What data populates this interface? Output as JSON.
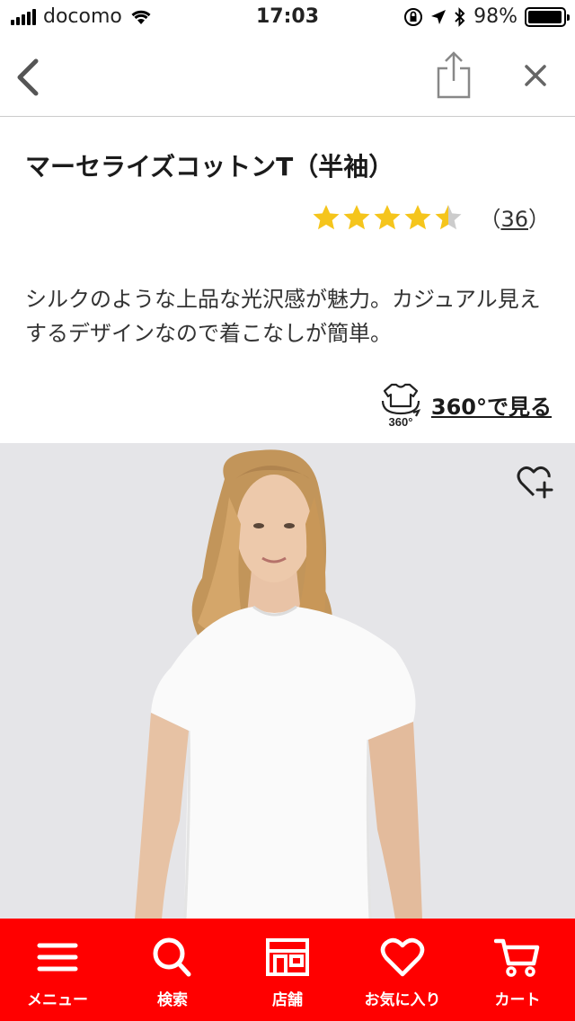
{
  "status_bar": {
    "carrier": "docomo",
    "time": "17:03",
    "battery": "98%",
    "battery_level": 0.98
  },
  "nav": {
    "back_icon": "chevron-left-icon",
    "share_icon": "share-icon",
    "close_icon": "close-icon"
  },
  "product": {
    "title": "マーセライズコットンT（半袖）",
    "rating": 4.5,
    "review_open": "（",
    "review_count": "36",
    "review_close": "）",
    "description": "シルクのような上品な光沢感が魅力。カジュアル見えするデザインなので着こなしが簡単。",
    "view_360_label": "360°で見る",
    "view_360_icon_text": "360°"
  },
  "tab_bar": {
    "items": [
      {
        "label": "メニュー",
        "icon": "menu-icon"
      },
      {
        "label": "検索",
        "icon": "search-icon"
      },
      {
        "label": "店舗",
        "icon": "store-icon"
      },
      {
        "label": "お気に入り",
        "icon": "heart-icon"
      },
      {
        "label": "カート",
        "icon": "cart-icon"
      }
    ]
  },
  "colors": {
    "tab_bar": "#ff0000",
    "star": "#f5c51c",
    "star_empty": "#cccccc"
  }
}
